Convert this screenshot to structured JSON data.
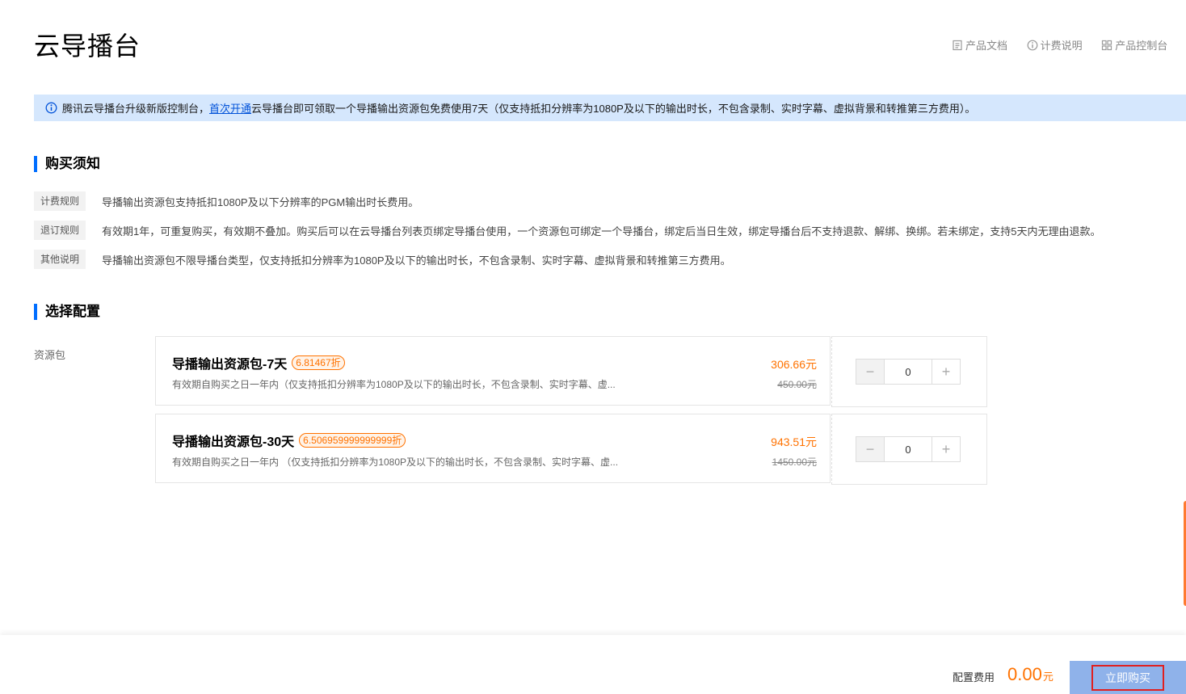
{
  "page": {
    "title": "云导播台"
  },
  "top_links": [
    {
      "label": "产品文档",
      "icon": "document-icon"
    },
    {
      "label": "计费说明",
      "icon": "info-circle-icon"
    },
    {
      "label": "产品控制台",
      "icon": "grid-icon"
    }
  ],
  "notice": {
    "prefix": "腾讯云导播台升级新版控制台，",
    "link": "首次开通",
    "suffix": "云导播台即可领取一个导播输出资源包免费使用7天（仅支持抵扣分辨率为1080P及以下的输出时长，不包含录制、实时字幕、虚拟背景和转推第三方费用）。"
  },
  "purchase_notes": {
    "title": "购买须知",
    "rules": [
      {
        "tag": "计费规则",
        "text": "导播输出资源包支持抵扣1080P及以下分辨率的PGM输出时长费用。"
      },
      {
        "tag": "退订规则",
        "text": "有效期1年，可重复购买，有效期不叠加。购买后可以在云导播台列表页绑定导播台使用，一个资源包可绑定一个导播台，绑定后当日生效，绑定导播台后不支持退款、解绑、换绑。若未绑定，支持5天内无理由退款。"
      },
      {
        "tag": "其他说明",
        "text": "导播输出资源包不限导播台类型，仅支持抵扣分辨率为1080P及以下的输出时长，不包含录制、实时字幕、虚拟背景和转推第三方费用。"
      }
    ]
  },
  "config": {
    "title": "选择配置",
    "field_label": "资源包",
    "packages": [
      {
        "name": "导播输出资源包-7天",
        "discount": "6.81467折",
        "desc": "有效期自购买之日一年内（仅支持抵扣分辨率为1080P及以下的输出时长，不包含录制、实时字幕、虚...",
        "price": "306.66元",
        "original_price": "450.00元",
        "quantity": "0"
      },
      {
        "name": "导播输出资源包-30天",
        "discount": "6.506959999999999折",
        "desc": "有效期自购买之日一年内 （仅支持抵扣分辨率为1080P及以下的输出时长，不包含录制、实时字幕、虚...",
        "price": "943.51元",
        "original_price": "1450.00元",
        "quantity": "0"
      }
    ]
  },
  "footer": {
    "fee_label": "配置费用",
    "amount": "0.00",
    "unit": "元",
    "buy_label": "立即购买"
  },
  "colors": {
    "accent": "#006eff",
    "price": "#ff7200",
    "notice_bg": "#d5e7fd",
    "buy_button": "#8fb2ea",
    "highlight_border": "#e02020"
  }
}
